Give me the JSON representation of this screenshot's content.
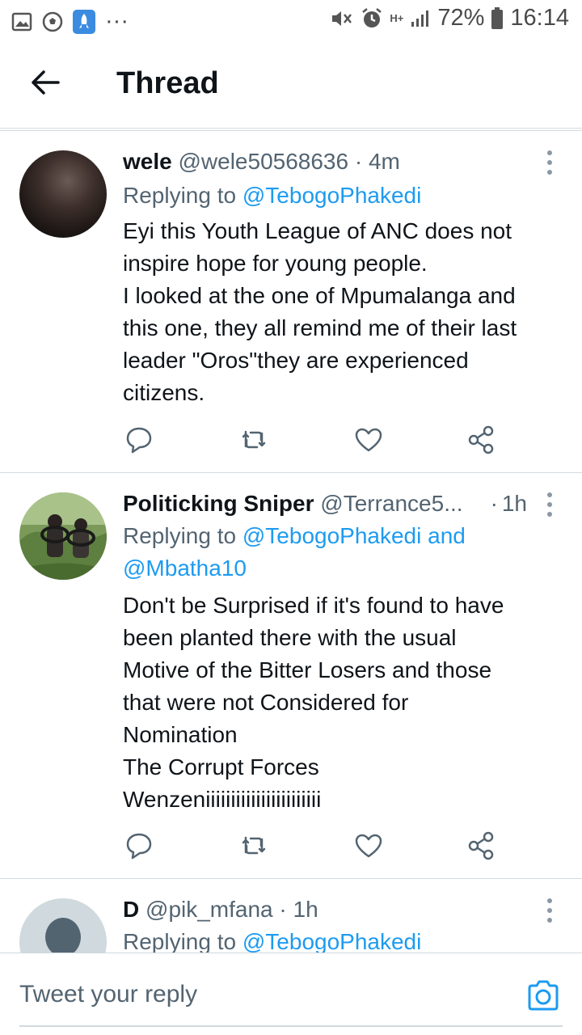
{
  "status_bar": {
    "left_icons": [
      "gallery-icon",
      "soccer-ball-icon",
      "rocket-app-icon",
      "more-dots"
    ],
    "more_dots": "···",
    "network": "H+",
    "battery_percent": "72%",
    "time": "16:14"
  },
  "header": {
    "back_icon": "arrow-left-icon",
    "title": "Thread"
  },
  "tweets": [
    {
      "display_name": "wele",
      "handle": "@wele50568636",
      "separator": "·",
      "time": "4m",
      "replying_prefix": "Replying to",
      "mentions": "@TebogoPhakedi",
      "body_lines": [
        "Eyi this Youth League of ANC does not",
        "inspire hope for young people.",
        "I looked at the one of Mpumalanga and",
        "this one, they all remind me of their last",
        "leader \"Oros\"they are experienced",
        "citizens."
      ]
    },
    {
      "display_name": "Politicking Sniper",
      "handle": "@Terrance5...",
      "separator": "·",
      "time": "1h",
      "replying_prefix": "Replying to",
      "mentions": "@TebogoPhakedi and",
      "mentions_line2": "@Mbatha10",
      "body_lines": [
        "Don't be Surprised if it's found to have",
        "been planted there with the usual",
        "Motive of the Bitter Losers and those",
        "that were not Considered for",
        "Nomination",
        "The Corrupt Forces",
        "Wenzeniiiiiiiiiiiiiiiiiiiiiii"
      ]
    },
    {
      "display_name": "D",
      "handle": "@pik_mfana",
      "separator": "·",
      "time": "1h",
      "replying_prefix": "Replying to",
      "mentions": "@TebogoPhakedi"
    }
  ],
  "action_icons": [
    "reply-icon",
    "retweet-icon",
    "like-icon",
    "share-icon"
  ],
  "composer": {
    "placeholder": "Tweet your reply",
    "camera_icon": "camera-icon"
  },
  "colors": {
    "accent": "#1d9bf0",
    "secondary_text": "#536471",
    "primary_text": "#0f1419",
    "divider": "#d5dbe0"
  }
}
